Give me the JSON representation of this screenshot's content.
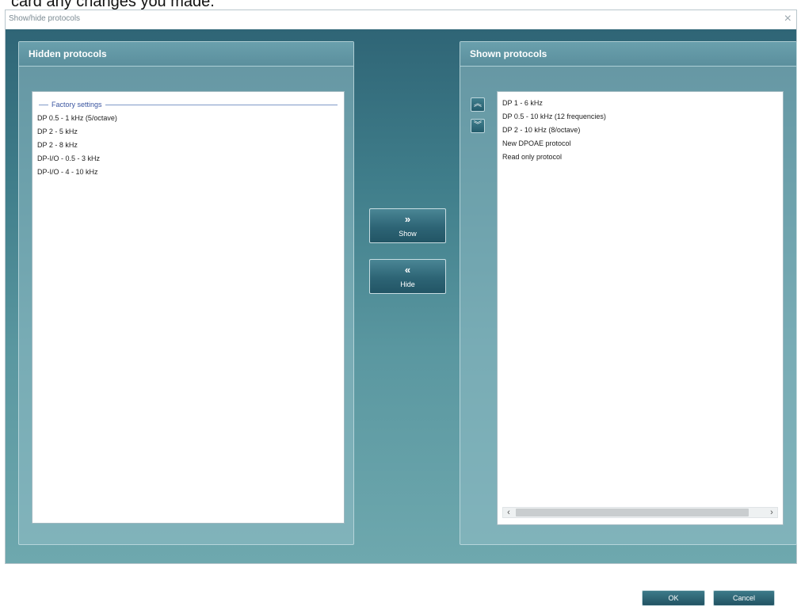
{
  "page": {
    "top_fragment": "card any changes you made."
  },
  "window": {
    "title": "Show/hide protocols",
    "close_glyph": "×"
  },
  "hidden_panel": {
    "header": "Hidden protocols",
    "group_label": "Factory settings",
    "items": [
      "DP 0.5 - 1 kHz (5/octave)",
      "DP 2 - 5 kHz",
      "DP 2 - 8 kHz",
      "DP-I/O - 0.5 - 3 kHz",
      "DP-I/O - 4 - 10 kHz"
    ]
  },
  "shown_panel": {
    "header": "Shown protocols",
    "move_up_icon": "chevron-double-up-icon",
    "move_down_icon": "chevron-double-down-icon",
    "items": [
      "DP 1 - 6 kHz",
      "DP 0.5 - 10 kHz (12 frequencies)",
      "DP 2 - 10 kHz (8/octave)",
      "New DPOAE protocol",
      "Read only protocol"
    ],
    "scroll_left": "‹",
    "scroll_right": "›"
  },
  "buttons": {
    "show_label": "Show",
    "show_glyph": "»",
    "hide_label": "Hide",
    "hide_glyph": "«",
    "up_glyph": "︽",
    "down_glyph": "︾",
    "ok": "OK",
    "cancel": "Cancel"
  },
  "colors": {
    "client_top": "#2f6576",
    "client_bottom": "#6ea8ae",
    "button": "#2d6475"
  }
}
